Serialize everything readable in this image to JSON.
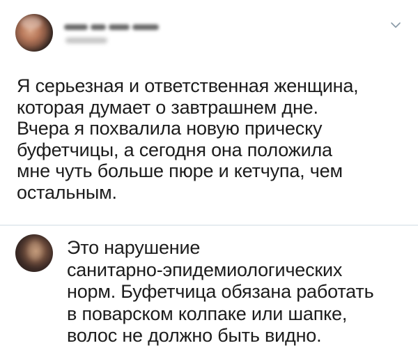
{
  "tweet": {
    "text": "Я серьезная и ответственная женщина,\nкоторая думает о завтрашнем дне.\nВчера я похвалила новую прическу\nбуфетчицы, а сегодня она положила\nмне чуть больше пюре и кетчупа, чем\nостальным."
  },
  "reply": {
    "text": "Это нарушение\nсанитарно-эпидемиологических\nнорм. Буфетчица обязана работать\nв поварском колпаке или шапке,\nволос не должно быть видно."
  },
  "icons": {
    "more": "chevron-down-icon"
  },
  "colors": {
    "text": "#1c1c1c",
    "divider": "#e6ecf0",
    "chevron": "#8899a6"
  }
}
